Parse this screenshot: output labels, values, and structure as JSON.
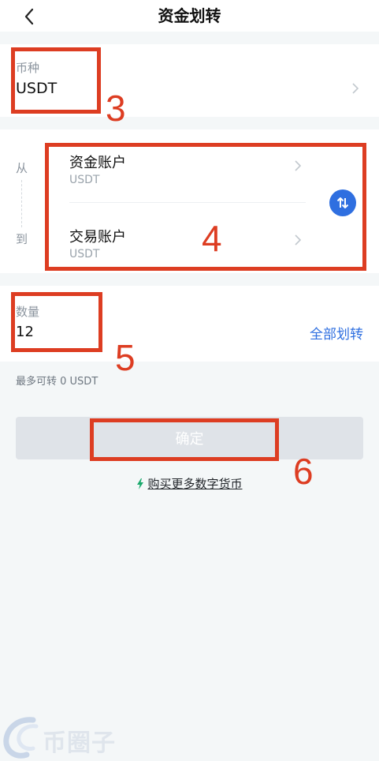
{
  "header": {
    "title": "资金划转"
  },
  "coin": {
    "label": "币种",
    "value": "USDT"
  },
  "transfer": {
    "from_label": "从",
    "to_label": "到",
    "from_account": {
      "name": "资金账户",
      "currency": "USDT"
    },
    "to_account": {
      "name": "交易账户",
      "currency": "USDT"
    }
  },
  "amount": {
    "label": "数量",
    "value": "12",
    "all_transfer_label": "全部划转",
    "max_text": "最多可转 0 USDT"
  },
  "confirm_label": "确定",
  "buy_link": "购买更多数字货币",
  "annotations": [
    "3",
    "4",
    "5",
    "6"
  ],
  "watermark": "币圈子",
  "colors": {
    "accent": "#2f6fe0",
    "annotation": "#dd3d22",
    "link_icon": "#18a86b"
  }
}
